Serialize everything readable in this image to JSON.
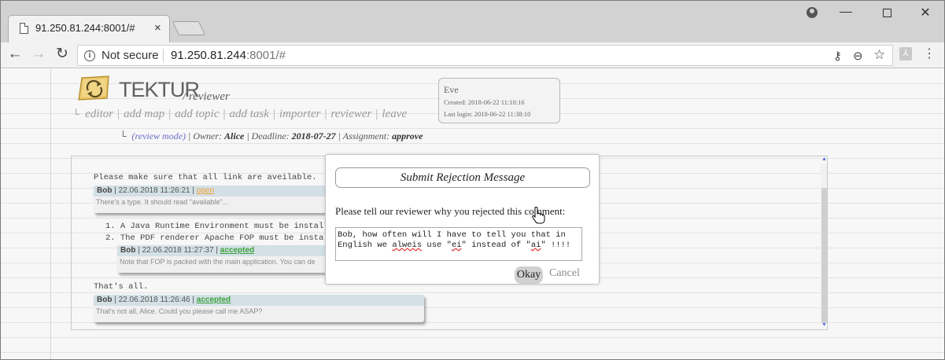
{
  "browser": {
    "tab_title": "91.250.81.244:8001/#",
    "tab_close": "×",
    "security_label": "Not secure",
    "url_host": "91.250.81.244",
    "url_rest": ":8001/#",
    "back_icon": "←",
    "forward_icon": "→",
    "reload_icon": "↻",
    "window_minimize": "—",
    "window_close": "✕",
    "menu_icon": "⋮",
    "key_icon": "⚷",
    "zoom_icon": "⊖",
    "star_icon": "☆"
  },
  "app": {
    "brand": "TEKTUR",
    "brand_sub": "/ reviewer",
    "nav": {
      "prefix": "└",
      "editor": "editor",
      "add_map": "add map",
      "add_topic": "add topic",
      "add_task": "add task",
      "importer": "importer",
      "reviewer": "reviewer",
      "leave": "leave",
      "separator": "|"
    },
    "meta": {
      "prefix": "└",
      "review_mode": "(review mode)",
      "owner_label": "Owner:",
      "owner": "Alice",
      "deadline_label": "Deadline:",
      "deadline": "2018-07-27",
      "assignment_label": "Assignment:",
      "assignment": "approve"
    },
    "user": {
      "name": "Eve",
      "created": "Created: 2018-06-22 11:10:16",
      "last_login": "Last login: 2018-06-22 11:38:10"
    }
  },
  "document": {
    "line1": "Please make sure that all link are aveilable.",
    "comments": [
      {
        "author": "Bob",
        "date": "| 22.06.2018 11:26:21 |",
        "status": "open",
        "text": "There's a type. It should read \"available\"..."
      },
      {
        "author": "Bob",
        "date": "| 22.06.2018 11:27:37 |",
        "status": "accepted",
        "text": "Note that FOP is packed with the main application. You can de"
      },
      {
        "author": "Bob",
        "date": "| 22.06.2018 11:26:46 |",
        "status": "accepted",
        "text": "That's not all, Alice. Could you please call me ASAP?"
      }
    ],
    "list": [
      "1. A Java Runtime Environment must be install",
      "2. The PDF renderer Apache FOP must be instal"
    ],
    "line_end": "That's all."
  },
  "modal": {
    "title": "Submit Rejection Message",
    "prompt": "Please tell our reviewer why you rejected this comment:",
    "message_part1": "Bob, how often will I have to tell you that in\nEnglish we ",
    "message_misspelled": "alweis",
    "message_part2": " use \"",
    "message_ei": "ei",
    "message_part3": "\" instead of \"",
    "message_ai": "ai",
    "message_part4": "\" !!!!",
    "okay_label": "Okay",
    "cancel_label": "Cancel"
  },
  "colors": {
    "accepted": "#3aa13a",
    "open": "#f0a030",
    "review_mode": "#6a6ac8",
    "comment_header": "#d3e0e6"
  }
}
